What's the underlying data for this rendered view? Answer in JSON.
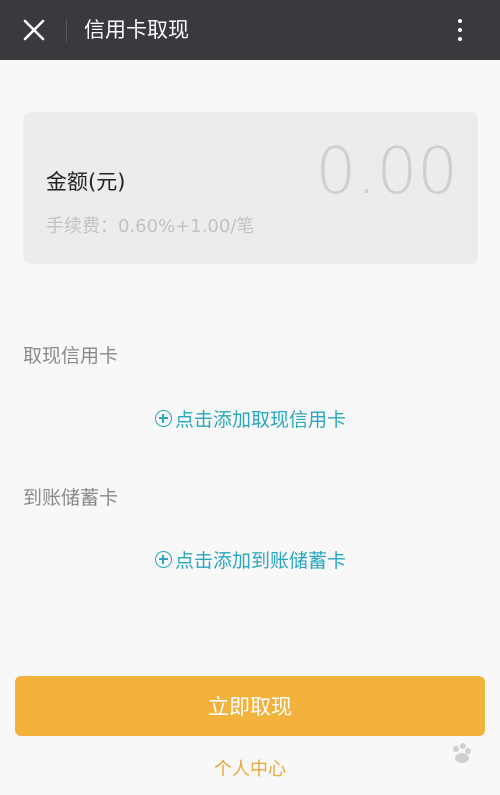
{
  "header": {
    "title": "信用卡取现",
    "close_icon": "close-icon",
    "more_icon": "more-vertical-icon"
  },
  "amount": {
    "label": "金额(元)",
    "value": "0.00",
    "fee": "手续费：0.60%+1.00/笔"
  },
  "credit_card": {
    "section_title": "取现信用卡",
    "add_label": "点击添加取现信用卡"
  },
  "debit_card": {
    "section_title": "到账储蓄卡",
    "add_label": "点击添加到账储蓄卡"
  },
  "actions": {
    "withdraw_label": "立即取现",
    "personal_center_label": "个人中心"
  },
  "colors": {
    "header_bg": "#393a3e",
    "accent_orange": "#f3b23c",
    "link_teal": "#2aa7c0",
    "link_gold": "#e8a93a"
  }
}
